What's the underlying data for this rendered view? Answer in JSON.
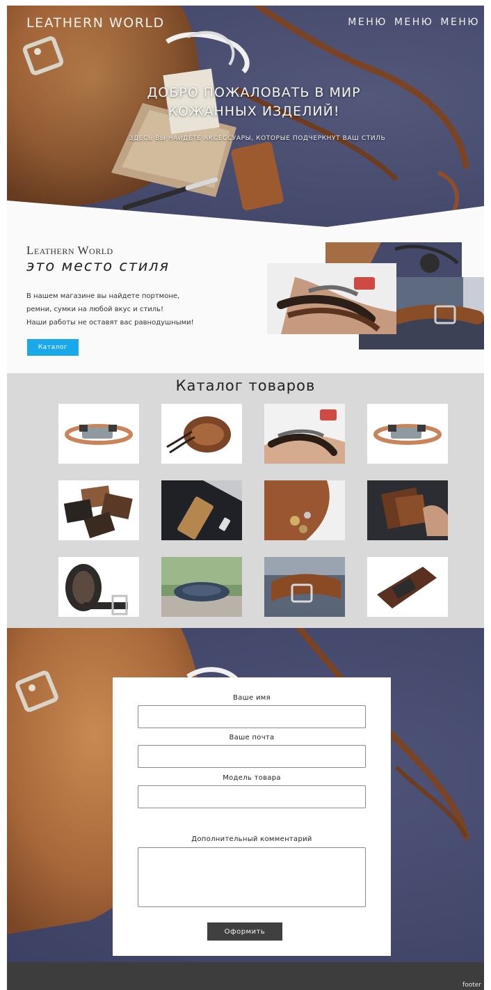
{
  "nav": {
    "logo": "LEATHERN WORLD",
    "menu": [
      "МЕНЮ",
      "МЕНЮ",
      "МЕНЮ"
    ]
  },
  "hero": {
    "title_line1": "ДОБРО ПОЖАЛОВАТЬ В МИР",
    "title_line2": "КОЖАННЫХ ИЗДЕЛИЙ!",
    "subtitle": "ЗДЕСЬ ВЫ НАЙДЕТЕ АКСЕССУАРЫ, КОТОРЫЕ ПОДЧЕРКНУТ ВАШ СТИЛЬ"
  },
  "about": {
    "brand": "Leathern World",
    "tagline": "это место стиля",
    "text_lines": [
      "В нашем магазине вы найдете портмоне,",
      "ремни, сумки на любой вкус и стиль!",
      "Наши работы не оставят вас равнодушными!"
    ],
    "catalog_button": "Каталог"
  },
  "catalog": {
    "title": "Каталог товаров",
    "items": [
      "bracelet",
      "wide-cuff",
      "wrist-wrap",
      "bracelet",
      "card-holders",
      "slim-wallet",
      "coin-purse",
      "bifold-wallet",
      "rolled-belts",
      "denim-belt",
      "brown-belt",
      "buckle-belt"
    ]
  },
  "order_form": {
    "name_label": "Ваше имя",
    "email_label": "Ваше почта",
    "model_label": "Модель товара",
    "comment_label": "Дополнительный комментарий",
    "name_value": "",
    "email_value": "",
    "model_value": "",
    "comment_value": "",
    "submit_label": "Оформить"
  },
  "footer": {
    "text": "footer"
  },
  "colors": {
    "hero_bg": "#474b6e",
    "leather": "#a86a3c",
    "catalog_bg": "#d9d9d9",
    "button_blue": "#19a9ea",
    "submit_bg": "#404040",
    "footer_bg": "#3d3d3d"
  }
}
